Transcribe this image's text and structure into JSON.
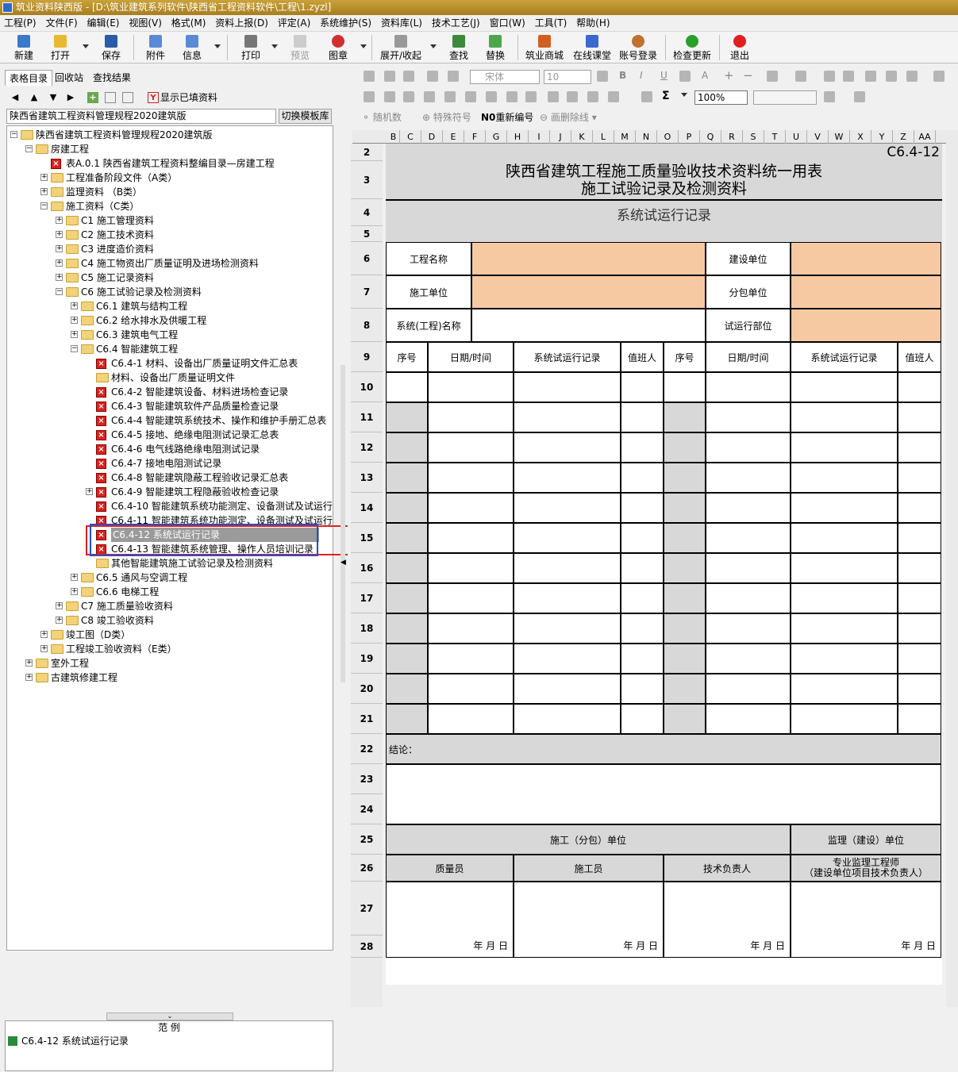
{
  "window": {
    "title": "筑业资料陕西版 - [D:\\筑业建筑系列软件\\陕西省工程资料软件\\工程\\1.zyzl]"
  },
  "menu": [
    "工程(P)",
    "文件(F)",
    "编辑(E)",
    "视图(V)",
    "格式(M)",
    "资料上报(D)",
    "评定(A)",
    "系统维护(S)",
    "资料库(L)",
    "技术工艺(J)",
    "窗口(W)",
    "工具(T)",
    "帮助(H)"
  ],
  "toolbar": {
    "new": "新建",
    "open": "打开",
    "save": "保存",
    "attach": "附件",
    "info": "信息",
    "print": "打印",
    "preview": "预览",
    "stamp": "图章",
    "expand": "展开/收起",
    "find": "查找",
    "replace": "替换",
    "mall": "筑业商城",
    "course": "在线课堂",
    "login": "账号登录",
    "update": "检查更新",
    "exit": "退出"
  },
  "left": {
    "tabs": [
      "表格目录",
      "回收站",
      "查找结果"
    ],
    "show_filled": "显示已填资料",
    "library": "陕西省建筑工程资料管理规程2020建筑版",
    "switch_btn": "切换模板库",
    "tree": [
      "陕西省建筑工程资料管理规程2020建筑版",
      "房建工程",
      "表A.0.1 陕西省建筑工程资料整编目录—房建工程",
      "工程准备阶段文件（A类）",
      "监理资料 （B类）",
      "施工资料（C类）",
      "C1 施工管理资料",
      "C2 施工技术资料",
      "C3 进度造价资料",
      "C4 施工物资出厂质量证明及进场检测资料",
      "C5 施工记录资料",
      "C6 施工试验记录及检测资料",
      "C6.1 建筑与结构工程",
      "C6.2 给水排水及供暖工程",
      "C6.3 建筑电气工程",
      "C6.4 智能建筑工程",
      "C6.4-1 材料、设备出厂质量证明文件汇总表",
      "材料、设备出厂质量证明文件",
      "C6.4-2 智能建筑设备、材料进场检查记录",
      "C6.4-3 智能建筑软件产品质量检查记录",
      "C6.4-4 智能建筑系统技术、操作和维护手册汇总表",
      "C6.4-5 接地、绝缘电阻测试记录汇总表",
      "C6.4-6 电气线路绝缘电阻测试记录",
      "C6.4-7 接地电阻测试记录",
      "C6.4-8 智能建筑隐蔽工程验收记录汇总表",
      "C6.4-9 智能建筑工程隐蔽验收检查记录",
      "C6.4-10 智能建筑系统功能测定、设备测试及试运行",
      "C6.4-11 智能建筑系统功能测定、设备测试及试运行",
      "C6.4-12 系统试运行记录",
      "C6.4-13 智能建筑系统管理、操作人员培训记录",
      "其他智能建筑施工试验记录及检测资料",
      "C6.5 通风与空调工程",
      "C6.6 电梯工程",
      "C7 施工质量验收资料",
      "C8 竣工验收资料",
      "竣工图（D类）",
      "工程竣工验收资料（E类）",
      "室外工程",
      "古建筑修建工程"
    ],
    "sample_label": "范  例",
    "sample_item": "C6.4-12 系统试运行记录"
  },
  "format": {
    "font": "宋体",
    "size": "10",
    "zoom": "100%",
    "random": "随机数",
    "special": "特殊符号",
    "renumber": "重新编号",
    "strike": "画删除线"
  },
  "columns": [
    "B",
    "C",
    "D",
    "E",
    "F",
    "G",
    "H",
    "I",
    "J",
    "K",
    "L",
    "M",
    "N",
    "O",
    "P",
    "Q",
    "R",
    "S",
    "T",
    "U",
    "V",
    "W",
    "X",
    "Y",
    "Z",
    "AA"
  ],
  "rows": [
    "2",
    "3",
    "4",
    "5",
    "6",
    "7",
    "8",
    "9",
    "10",
    "11",
    "12",
    "13",
    "14",
    "15",
    "16",
    "17",
    "18",
    "19",
    "20",
    "21",
    "22",
    "23",
    "24",
    "25",
    "26",
    "27",
    "28"
  ],
  "form": {
    "code": "C6.4-12",
    "title1": "陕西省建筑工程施工质量验收技术资料统一用表",
    "title2": "施工试验记录及检测资料",
    "subtitle": "系统试运行记录",
    "project_name": "工程名称",
    "builder": "建设单位",
    "contractor": "施工单位",
    "subcontractor": "分包单位",
    "system_name": "系统(工程)名称",
    "trial_part": "试运行部位",
    "col_seq": "序号",
    "col_date": "日期/时间",
    "col_record": "系统试运行记录",
    "col_duty": "值班人",
    "conclusion": "结论：",
    "sign_contractor": "施工（分包）单位",
    "sign_supervisor": "监理（建设）单位",
    "qc": "质量员",
    "worker": "施工员",
    "tech": "技术负责人",
    "engineer": "专业监理工程师",
    "engineer2": "（建设单位项目技术负责人）",
    "date": "年  月  日"
  }
}
